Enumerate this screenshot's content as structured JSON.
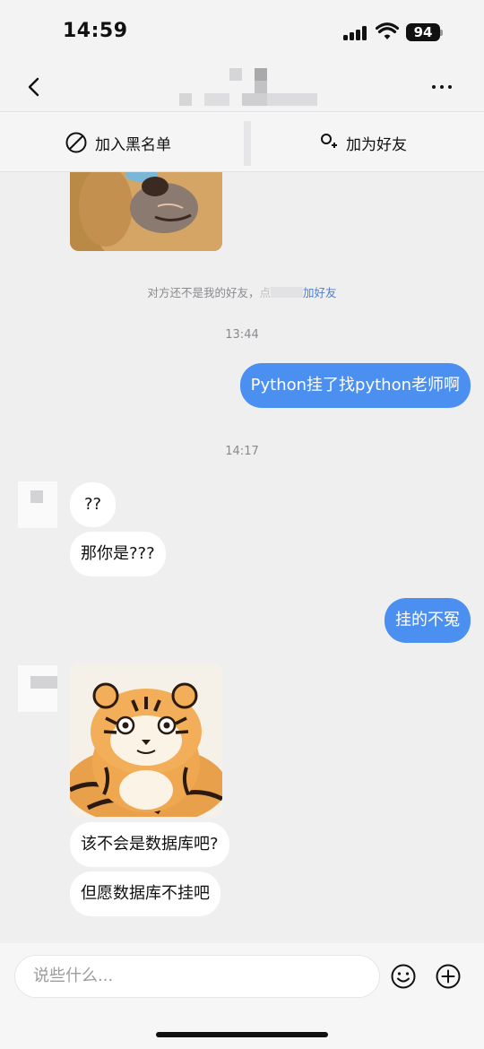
{
  "status_bar": {
    "time": "14:59",
    "battery": "94"
  },
  "header": {
    "title_obscured": true
  },
  "actions": {
    "block_label": "加入黑名单",
    "add_friend_label": "加为好友"
  },
  "system_notice": {
    "text_before": "对方还不是我的好友，",
    "text_obscured": "点",
    "link_text": "加好友"
  },
  "messages": [
    {
      "type": "time",
      "text": "13:44"
    },
    {
      "type": "text",
      "direction": "out",
      "text": "Python挂了找python老师啊"
    },
    {
      "type": "time",
      "text": "14:17"
    },
    {
      "type": "text",
      "direction": "in",
      "text": "??"
    },
    {
      "type": "text",
      "direction": "in",
      "text": "那你是???"
    },
    {
      "type": "text",
      "direction": "out",
      "text": "挂的不冤"
    },
    {
      "type": "image",
      "direction": "in",
      "subject": "tiger sticker"
    },
    {
      "type": "text",
      "direction": "in",
      "text": "该不会是数据库吧?"
    },
    {
      "type": "text",
      "direction": "in",
      "text": "但愿数据库不挂吧"
    }
  ],
  "input": {
    "placeholder": "说些什么..."
  },
  "colors": {
    "outgoing_bubble": "#4b8ff0",
    "incoming_bubble": "#ffffff",
    "link": "#4a7fd6",
    "background": "#efeff0"
  },
  "icons": [
    "back-icon",
    "more-icon",
    "block-icon",
    "add-friend-icon",
    "emoji-icon",
    "plus-icon"
  ]
}
